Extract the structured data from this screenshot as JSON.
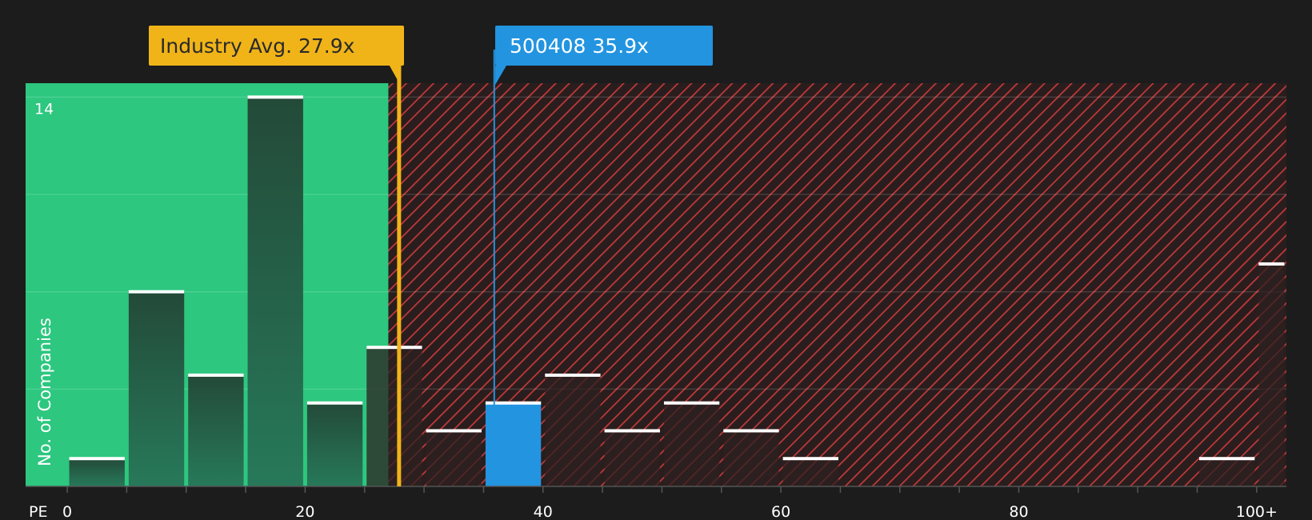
{
  "chart_data": {
    "type": "bar",
    "title": "",
    "xlabel": "PE",
    "ylabel": "No. of Companies",
    "x_bins": [
      {
        "from": 0,
        "to": 5,
        "count": 1
      },
      {
        "from": 5,
        "to": 10,
        "count": 7
      },
      {
        "from": 10,
        "to": 15,
        "count": 4
      },
      {
        "from": 15,
        "to": 20,
        "count": 14
      },
      {
        "from": 20,
        "to": 25,
        "count": 3
      },
      {
        "from": 25,
        "to": 30,
        "count": 5
      },
      {
        "from": 30,
        "to": 35,
        "count": 2
      },
      {
        "from": 35,
        "to": 40,
        "count": 3
      },
      {
        "from": 40,
        "to": 45,
        "count": 4
      },
      {
        "from": 45,
        "to": 50,
        "count": 2
      },
      {
        "from": 50,
        "to": 55,
        "count": 3
      },
      {
        "from": 55,
        "to": 60,
        "count": 2
      },
      {
        "from": 60,
        "to": 65,
        "count": 1
      },
      {
        "from": 65,
        "to": 70,
        "count": 0
      },
      {
        "from": 70,
        "to": 75,
        "count": 0
      },
      {
        "from": 75,
        "to": 80,
        "count": 0
      },
      {
        "from": 80,
        "to": 85,
        "count": 0
      },
      {
        "from": 85,
        "to": 90,
        "count": 0
      },
      {
        "from": 90,
        "to": 95,
        "count": 0
      },
      {
        "from": 95,
        "to": 100,
        "count": 1
      },
      {
        "from": 100,
        "to": 105,
        "count": 8
      }
    ],
    "xlim": [
      -3.5,
      102.5
    ],
    "ylim": [
      0,
      14.5
    ],
    "x_ticks": [
      {
        "value": 0,
        "label": "0"
      },
      {
        "value": 20,
        "label": "20"
      },
      {
        "value": 40,
        "label": "40"
      },
      {
        "value": 60,
        "label": "60"
      },
      {
        "value": 80,
        "label": "80"
      },
      {
        "value": 100,
        "label": "100+"
      }
    ],
    "y_ticks": [
      {
        "value": 14,
        "label": "14"
      }
    ],
    "gridlines_y": [
      3.5,
      7,
      10.5,
      14
    ],
    "industry_avg": {
      "value": 27.9,
      "label": "Industry Avg. 27.9x"
    },
    "company": {
      "value": 35.9,
      "label": "500408 35.9x"
    },
    "green_zone_end": 27,
    "colors": {
      "background": "#1c1c1c",
      "green_zone": "#2dc77f",
      "red_zone": "#2a1d1d",
      "red_hatch": "#c0393b",
      "bar_top": "#234a38",
      "bar_bottom": "#27795a",
      "bar_in_red": "#2d2020",
      "highlight": "#2394e0",
      "industry": "#f0b419",
      "cap": "#ffffff"
    }
  }
}
